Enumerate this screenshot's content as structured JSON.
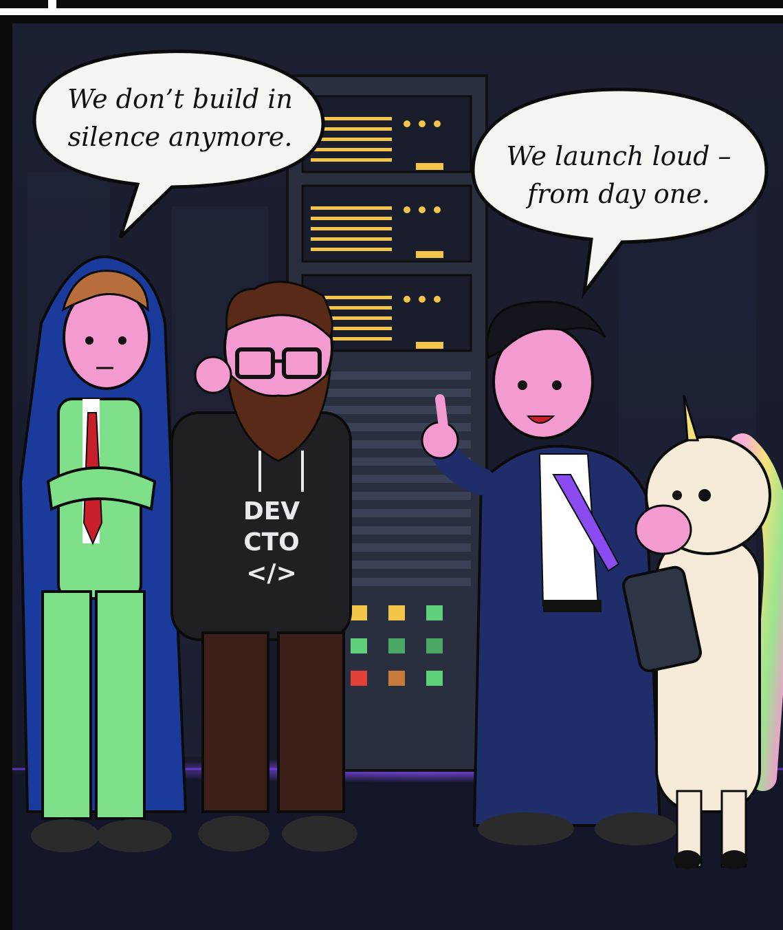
{
  "bubbles": {
    "left": {
      "line1": "We don’t build in",
      "line2": "silence anymore."
    },
    "right": {
      "line1": "We launch loud –",
      "line2": "from day one."
    }
  },
  "hoodie": {
    "line1": "DEV",
    "line2": "CTO",
    "line3": "</>"
  },
  "colors": {
    "background": "#1a1d2e",
    "frame": "#0b0b0b",
    "rack": "#2a2f40",
    "server_light_yellow": "#f3c64a",
    "server_light_green": "#5fd07a",
    "server_light_red": "#e2413a",
    "floor_glow": "#7a3cff",
    "green_suit": "#7fe08a",
    "blue_cape": "#1a3a9c",
    "navy_suit": "#1f2d6b",
    "purple_tie": "#8a4cf0",
    "unicorn_body": "#f6ead8"
  },
  "characters": [
    {
      "name": "green-suit-man",
      "icon": "person-cape"
    },
    {
      "name": "bearded-cto",
      "icon": "person-hoodie"
    },
    {
      "name": "pointing-founder",
      "icon": "person-suit"
    },
    {
      "name": "unicorn",
      "icon": "unicorn-tablet"
    }
  ]
}
